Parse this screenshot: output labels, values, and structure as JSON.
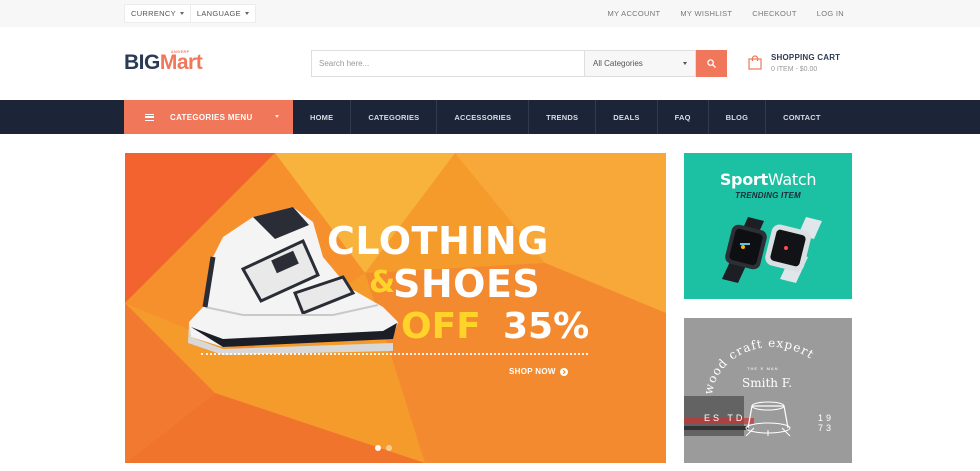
{
  "topbar": {
    "currency": "CURRENCY",
    "language": "LANGUAGE",
    "links": [
      "MY ACCOUNT",
      "MY WISHLIST",
      "CHECKOUT",
      "LOG IN"
    ]
  },
  "header": {
    "logo_big": "BIG",
    "logo_mart": "Mart",
    "logo_tag": "ANGERP",
    "search_placeholder": "Search here...",
    "category_select": "All Categories",
    "cart_title": "SHOPPING CART",
    "cart_sub": "0 ITEM - $0.00"
  },
  "nav": {
    "categories_menu": "CATEGORIES MENU",
    "items": [
      "HOME",
      "CATEGORIES",
      "ACCESSORIES",
      "TRENDS",
      "DEALS",
      "FAQ",
      "BLOG",
      "CONTACT"
    ]
  },
  "hero": {
    "line1": "CLOTHING",
    "amp": "&",
    "line2": "SHOES",
    "off": "OFF",
    "percent": "35%",
    "cta": "SHOP NOW"
  },
  "banner1": {
    "title_bold": "Sport",
    "title_light": "Watch",
    "subtitle": "TRENDING ITEM"
  },
  "banner2": {
    "arc_text": "wood craft expert",
    "the_mark": "THE ✕ MAN",
    "name": "Smith F.",
    "year_left": "ES TD",
    "year_right": "19 73"
  },
  "colors": {
    "accent": "#f0775a",
    "navy": "#1c2437",
    "teal": "#1cc0a2",
    "yellow": "#ffd42a"
  },
  "icons": [
    "caret-down-icon",
    "search-icon",
    "shopping-bag-icon",
    "hamburger-icon",
    "arrow-right-circle-icon"
  ]
}
